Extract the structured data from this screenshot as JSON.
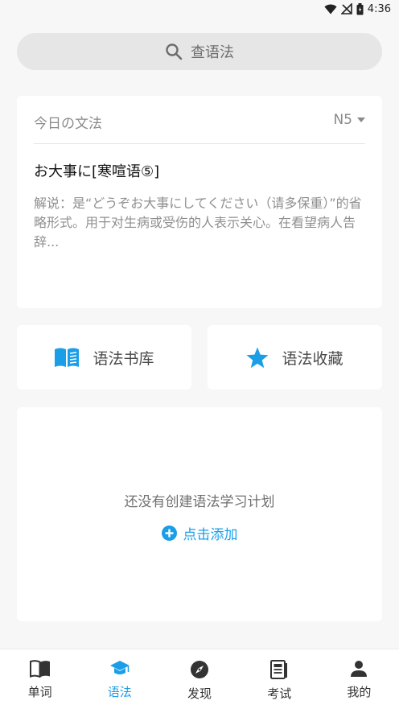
{
  "status_bar": {
    "time": "4:36"
  },
  "search": {
    "placeholder": "查语法",
    "icon": "search-icon"
  },
  "daily": {
    "title": "今日の文法",
    "level": "N5",
    "grammar_name": "お大事に[寒喧语⑤]",
    "description": "解说：是“どうぞお大事にしてください（请多保重）”的省略形式。用于对生病或受伤的人表示关心。在看望病人告辞..."
  },
  "actions": {
    "library_label": "语法书库",
    "favorites_label": "语法收藏"
  },
  "plan": {
    "empty_text": "还没有创建语法学习计划",
    "add_label": "点击添加"
  },
  "nav": {
    "items": [
      {
        "label": "单词",
        "icon": "book-icon",
        "active": false
      },
      {
        "label": "语法",
        "icon": "graduation-cap-icon",
        "active": true
      },
      {
        "label": "发现",
        "icon": "compass-icon",
        "active": false
      },
      {
        "label": "考试",
        "icon": "exam-paper-icon",
        "active": false
      },
      {
        "label": "我的",
        "icon": "person-icon",
        "active": false
      }
    ]
  },
  "colors": {
    "accent": "#1a9ee8",
    "background": "#f7f7f7",
    "card": "#ffffff"
  }
}
